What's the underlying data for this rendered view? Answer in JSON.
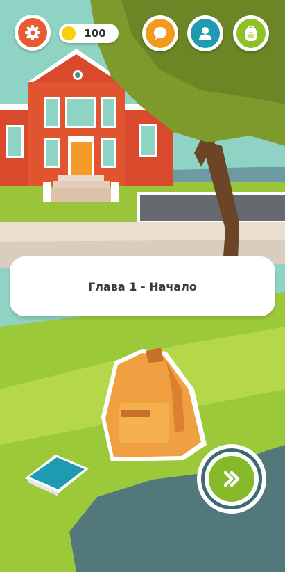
{
  "hud": {
    "coins": "100",
    "coin_color": "#f5d20a",
    "settings_icon": "gear-icon",
    "chat_icon": "speech-bubble-icon",
    "profile_icon": "user-icon",
    "backpack_icon": "backpack-icon",
    "settings_color": "#e65a36",
    "chat_color": "#f29a1f",
    "profile_color": "#1e9bb0",
    "backpack_color": "#8fc127"
  },
  "dialog": {
    "chapter_title": "Глава 1 - Начало"
  },
  "controls": {
    "next_icon": "double-chevron-right-icon",
    "next_color": "#86b92a"
  }
}
